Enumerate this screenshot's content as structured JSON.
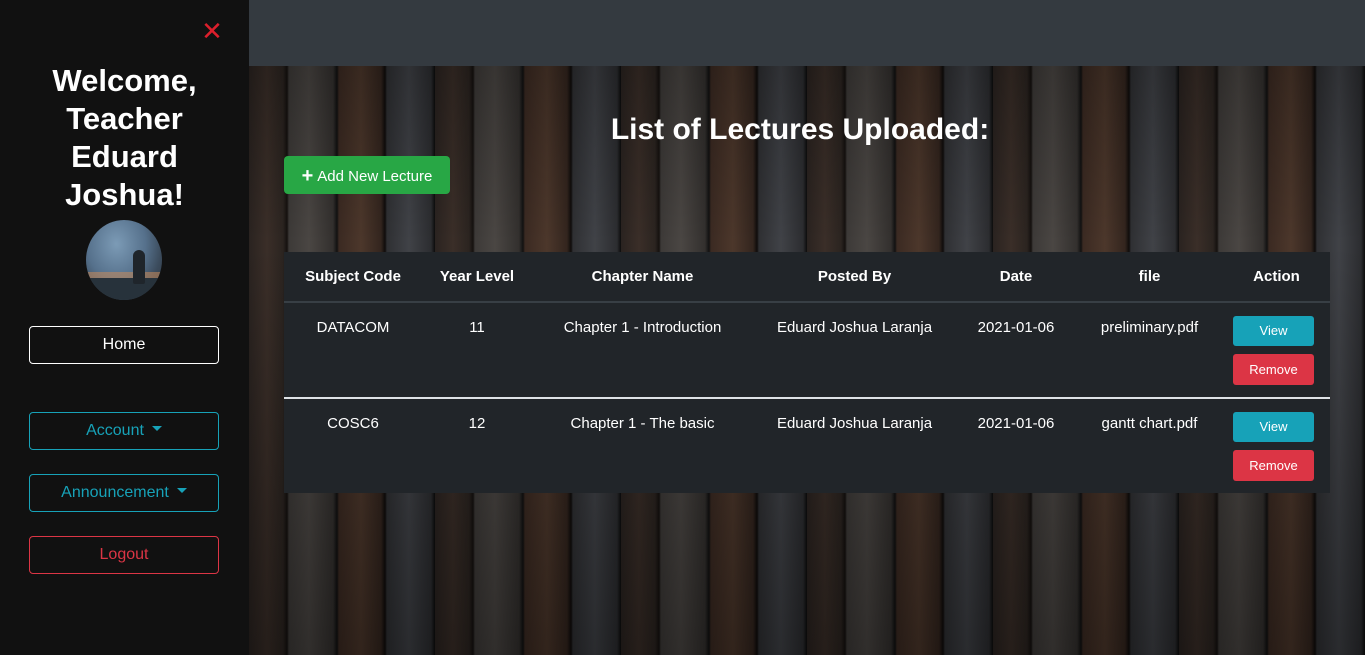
{
  "sidebar": {
    "close_icon": "close-icon",
    "welcome": "Welcome, Teacher Eduard Joshua!",
    "nav": {
      "home": "Home",
      "account": "Account",
      "announcement": "Announcement",
      "logout": "Logout"
    }
  },
  "main": {
    "title": "List of Lectures Uploaded:",
    "add_button": "Add New Lecture",
    "table": {
      "headers": [
        "Subject Code",
        "Year Level",
        "Chapter Name",
        "Posted By",
        "Date",
        "file",
        "Action"
      ],
      "rows": [
        {
          "subject_code": "DATACOM",
          "year_level": "11",
          "chapter_name": "Chapter 1 - Introduction",
          "posted_by": "Eduard Joshua Laranja",
          "date": "2021-01-06",
          "file": "preliminary.pdf"
        },
        {
          "subject_code": "COSC6",
          "year_level": "12",
          "chapter_name": "Chapter 1 - The basic",
          "posted_by": "Eduard Joshua Laranja",
          "date": "2021-01-06",
          "file": "gantt chart.pdf"
        }
      ],
      "view_label": "View",
      "remove_label": "Remove"
    }
  },
  "colors": {
    "sidebar_bg": "#111111",
    "topbar_bg": "#343a40",
    "table_bg": "#212529",
    "success": "#28a745",
    "info": "#17a2b8",
    "danger": "#dc3545"
  }
}
